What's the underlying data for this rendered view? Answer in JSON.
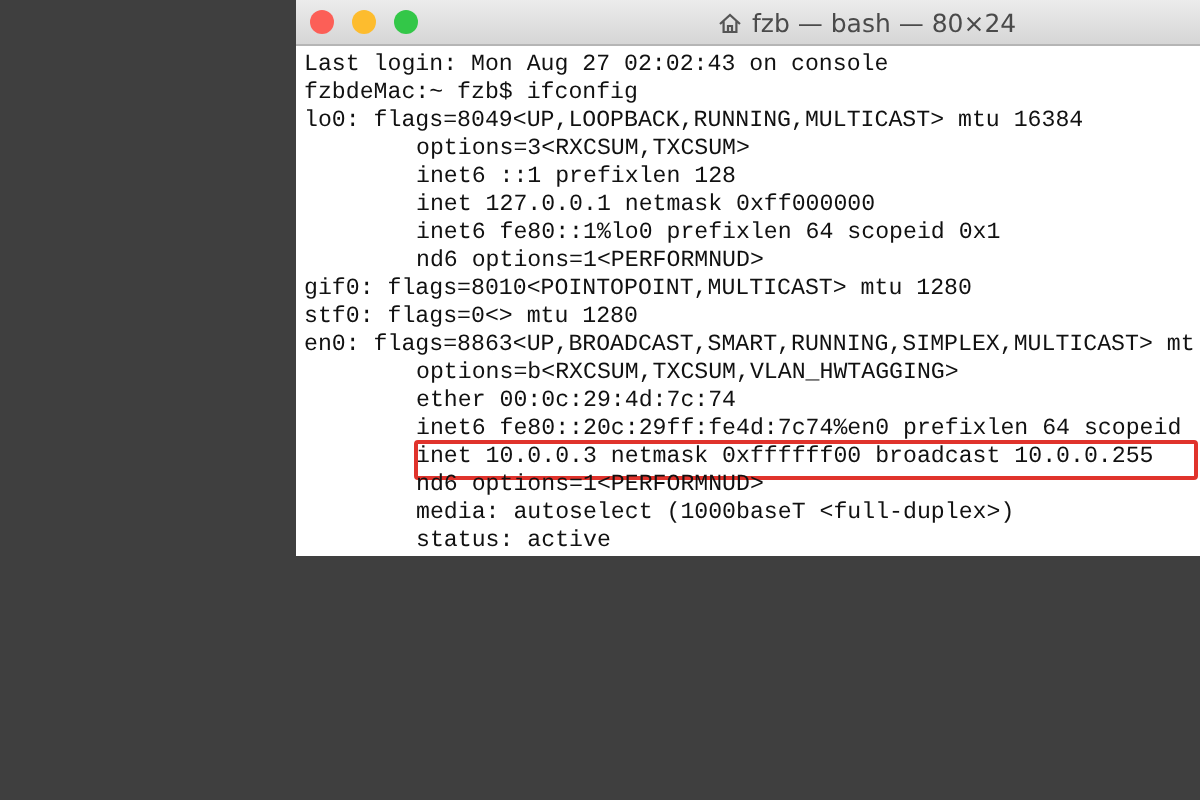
{
  "window": {
    "title": "fzb — bash — 80×24"
  },
  "terminal": {
    "lines": [
      {
        "text": "Last login: Mon Aug 27 02:02:43 on console"
      },
      {
        "text": "fzbdeMac:~ fzb$ ifconfig"
      },
      {
        "text": "lo0: flags=8049<UP,LOOPBACK,RUNNING,MULTICAST> mtu 16384",
        "children": [
          {
            "text": "options=3<RXCSUM,TXCSUM>"
          },
          {
            "text": "inet6 ::1 prefixlen 128"
          },
          {
            "text": "inet 127.0.0.1 netmask 0xff000000"
          },
          {
            "text": "inet6 fe80::1%lo0 prefixlen 64 scopeid 0x1"
          },
          {
            "text": "nd6 options=1<PERFORMNUD>"
          }
        ]
      },
      {
        "text": "gif0: flags=8010<POINTOPOINT,MULTICAST> mtu 1280"
      },
      {
        "text": "stf0: flags=0<> mtu 1280"
      },
      {
        "text": "en0: flags=8863<UP,BROADCAST,SMART,RUNNING,SIMPLEX,MULTICAST> mt",
        "children": [
          {
            "text": "options=b<RXCSUM,TXCSUM,VLAN_HWTAGGING>"
          },
          {
            "text": "ether 00:0c:29:4d:7c:74"
          },
          {
            "text": "inet6 fe80::20c:29ff:fe4d:7c74%en0 prefixlen 64 scopeid"
          },
          {
            "text": "inet 10.0.0.3 netmask 0xffffff00 broadcast 10.0.0.255",
            "highlighted": true
          },
          {
            "text": "nd6 options=1<PERFORMNUD>"
          },
          {
            "text": "media: autoselect (1000baseT <full-duplex>)"
          },
          {
            "text": "status: active"
          }
        ]
      }
    ]
  }
}
